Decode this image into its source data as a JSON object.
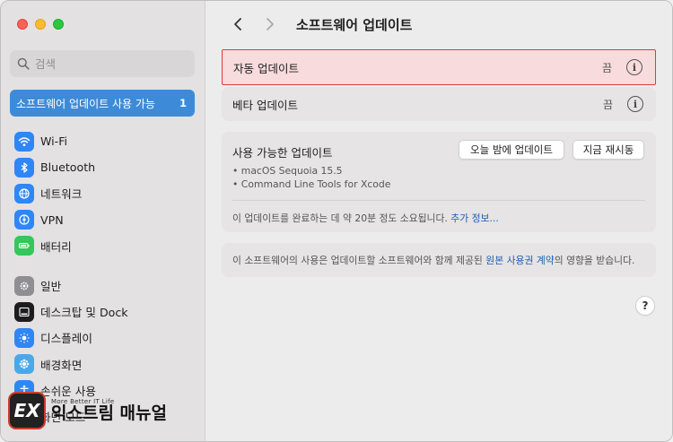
{
  "window": {
    "title": "소프트웨어 업데이트"
  },
  "search": {
    "placeholder": "검색"
  },
  "sidebar": {
    "selected": {
      "label": "소프트웨어 업데이트 사용 가능",
      "badge": "1"
    },
    "groups": [
      [
        {
          "label": "Wi-Fi",
          "icon": "wifi-icon",
          "color": "#2f86f6"
        },
        {
          "label": "Bluetooth",
          "icon": "bluetooth-icon",
          "color": "#2f86f6"
        },
        {
          "label": "네트워크",
          "icon": "globe-icon",
          "color": "#2f86f6"
        },
        {
          "label": "VPN",
          "icon": "vpn-icon",
          "color": "#2f86f6"
        },
        {
          "label": "배터리",
          "icon": "battery-icon",
          "color": "#34c759"
        }
      ],
      [
        {
          "label": "일반",
          "icon": "gear-icon",
          "color": "#8e8e93"
        },
        {
          "label": "데스크탑 및 Dock",
          "icon": "dock-icon",
          "color": "#1c1c1e"
        },
        {
          "label": "디스플레이",
          "icon": "display-icon",
          "color": "#2f86f6"
        },
        {
          "label": "배경화면",
          "icon": "wallpaper-icon",
          "color": "#4aa8e8"
        },
        {
          "label": "손쉬운 사용",
          "icon": "accessibility-icon",
          "color": "#2f86f6"
        },
        {
          "label": "화면 모드",
          "icon": "screen-mode-icon",
          "color": "#1c1c1e"
        }
      ]
    ]
  },
  "rows": {
    "auto_update": {
      "label": "자동 업데이트",
      "status": "끔"
    },
    "beta_update": {
      "label": "베타 업데이트",
      "status": "끔"
    }
  },
  "updates": {
    "title": "사용 가능한 업데이트",
    "tonight_button": "오늘 밤에 업데이트",
    "restart_button": "지금 재시동",
    "items": [
      "• macOS Sequoia 15.5",
      "• Command Line Tools for Xcode"
    ],
    "note": "이 업데이트를 완료하는 데 약 20분 정도 소요됩니다.",
    "more_link": "추가 정보..."
  },
  "license": {
    "text_before": "이 소프트웨어의 사용은 업데이트할 소프트웨어와 함께 제공된 ",
    "link": "원본 사용권 계약",
    "text_after": "의 영향을 받습니다."
  },
  "help": {
    "label": "?"
  },
  "watermark": {
    "mark": "EX",
    "sub": "More Better IT Life",
    "main": "익스트림 매뉴얼"
  },
  "colors": {
    "accent": "#3d8bd8",
    "highlight_border": "#e03a3a",
    "highlight_fill": "#f8dbdd",
    "link": "#1a5fb4"
  }
}
